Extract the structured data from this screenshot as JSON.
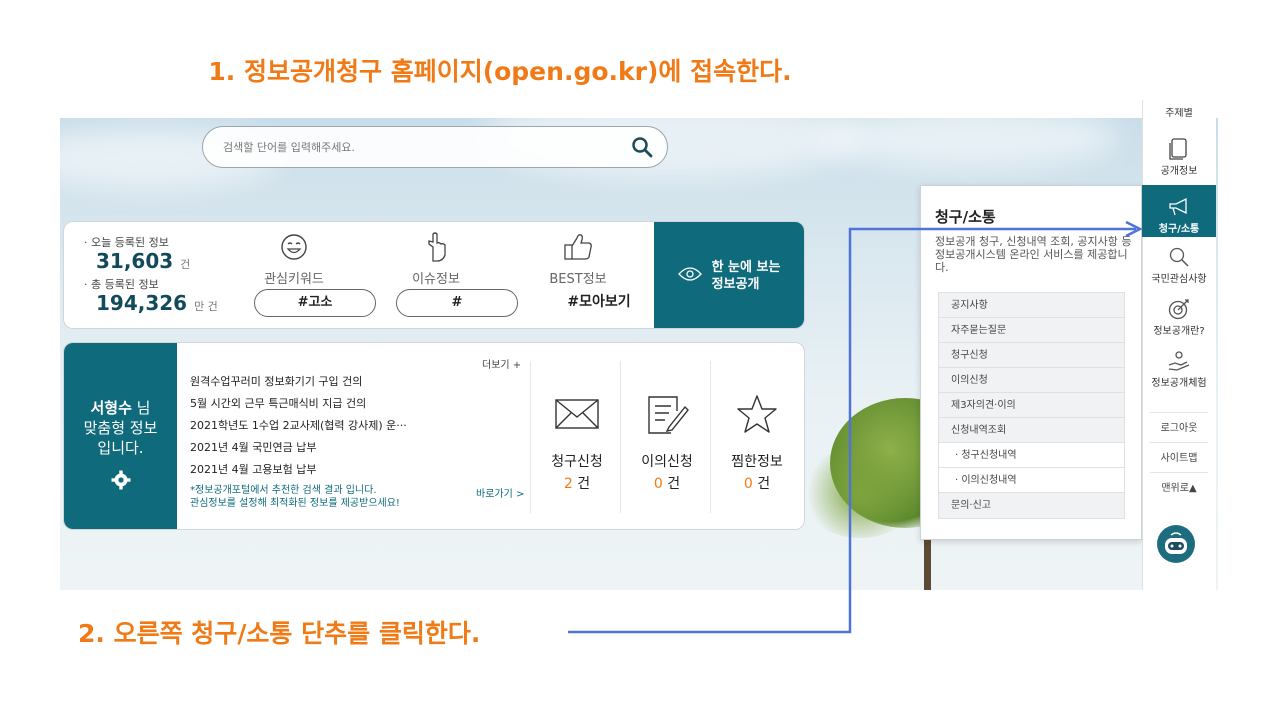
{
  "captions": {
    "step1": "1. 정보공개청구 홈페이지(open.go.kr)에 접속한다.",
    "step2": "2. 오른쪽 청구/소통 단추를 클릭한다."
  },
  "search": {
    "placeholder": "검색할 단어를 입력해주세요."
  },
  "stats": {
    "today_label": "· 오늘 등록된 정보",
    "today_value": "31,603",
    "today_unit": "건",
    "total_label": "· 총 등록된 정보",
    "total_value": "194,326",
    "total_unit": "만 건"
  },
  "keyword_cols": [
    {
      "label": "관심키워드",
      "tag": "#고소"
    },
    {
      "label": "이슈정보",
      "tag": "#"
    },
    {
      "label": "BEST정보",
      "tag": "#모아보기"
    }
  ],
  "glance": {
    "line1": "한 눈에 보는",
    "line2": "정보공개"
  },
  "personal": {
    "name": "서형수",
    "suffix": " 님",
    "line2": "맞춤형 정보",
    "line3": "입니다.",
    "more": "더보기 +",
    "items": [
      "원격수업꾸러미 정보화기기 구입 건의",
      "5월 시간외 근무 특근매식비 지급 건의",
      "2021학년도 1수업 2교사제(협력 강사제) 운···",
      "2021년 4월 국민연금 납부",
      "2021년 4월 고용보험 납부"
    ],
    "note1": "*정보공개포털에서 추천한 검색 결과 입니다.",
    "note2": "관심정보를 설정해 최적화된 정보를 제공받으세요!",
    "goto": "바로가기 >",
    "actions": [
      {
        "label": "청구신청",
        "count": "2",
        "unit": " 건"
      },
      {
        "label": "이의신청",
        "count": "0",
        "unit": " 건"
      },
      {
        "label": "찜한정보",
        "count": "0",
        "unit": " 건"
      }
    ]
  },
  "dropdown": {
    "title": "청구/소통",
    "desc": "정보공개 청구, 신청내역 조회, 공지사항 등 정보공개시스템 온라인 서비스를 제공합니다.",
    "menu": [
      {
        "label": "공지사항"
      },
      {
        "label": "자주묻는질문"
      },
      {
        "label": "청구신청"
      },
      {
        "label": "이의신청"
      },
      {
        "label": "제3자의견·이의"
      },
      {
        "label": "신청내역조회"
      },
      {
        "label": "· 청구신청내역"
      },
      {
        "label": "· 이의신청내역"
      },
      {
        "label": "문의·신고"
      }
    ]
  },
  "sidebar": {
    "cut_top": "주제별",
    "items": [
      "공개정보",
      "청구/소통",
      "국민관심사항",
      "정보공개란?",
      "정보공개체험"
    ],
    "links": [
      "로그아웃",
      "사이트맵",
      "맨위로▲"
    ]
  },
  "colors": {
    "teal": "#0f6b7c",
    "orange": "#f07b16",
    "arrow": "#4f74d6"
  }
}
